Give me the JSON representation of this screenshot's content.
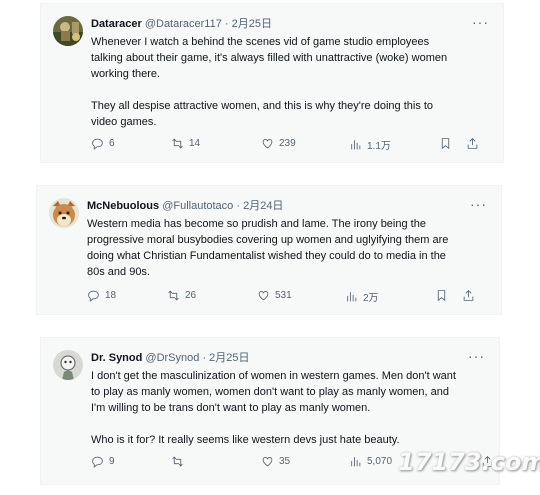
{
  "tweets": [
    {
      "author_name": "Dataracer",
      "handle": "@Dataracer117",
      "dot": "·",
      "date": "2月25日",
      "more": "···",
      "lines": [
        "Whenever I watch a behind the scenes vid of game studio employees",
        "talking about their game, it's always filled with unattractive (woke) women",
        "working there.",
        "",
        "They all despise attractive women, and this is why they're doing this to",
        "video games."
      ],
      "replies": "6",
      "retweets": "14",
      "likes": "239",
      "views": "1.1万"
    },
    {
      "author_name": "McNebuolous",
      "handle": "@Fullautotaco",
      "dot": "·",
      "date": "2月24日",
      "more": "···",
      "lines": [
        "Western media has become so prudish and lame.  The irony being the",
        "progressive moral busybodies covering up women and uglyifying them are",
        "doing what Christian Fundamentalist wished they could do to media in the",
        "80s and 90s."
      ],
      "replies": "18",
      "retweets": "26",
      "likes": "531",
      "views": "2万"
    },
    {
      "author_name": "Dr. Synod",
      "handle": "@DrSynod",
      "dot": "·",
      "date": "2月25日",
      "more": "···",
      "lines": [
        "I don't get the masculinization of women in western games. Men don't want",
        "to play as manly women, women don't want to play as manly women, and",
        "I'm willing to be trans don't want to play as manly women.",
        "",
        "Who is it for? It really seems like western devs just hate beauty."
      ],
      "replies": "9",
      "retweets": "",
      "likes": "35",
      "views": "5,070"
    }
  ],
  "icons": {
    "reply": "reply-icon",
    "retweet": "retweet-icon",
    "like": "heart-icon",
    "views": "views-chart-icon",
    "bookmark": "bookmark-icon",
    "share": "share-icon"
  },
  "watermark": "17173.com",
  "colors": {
    "card_background": "#f7f9f9",
    "primary_text": "#0f1419",
    "secondary_text": "#536471"
  }
}
